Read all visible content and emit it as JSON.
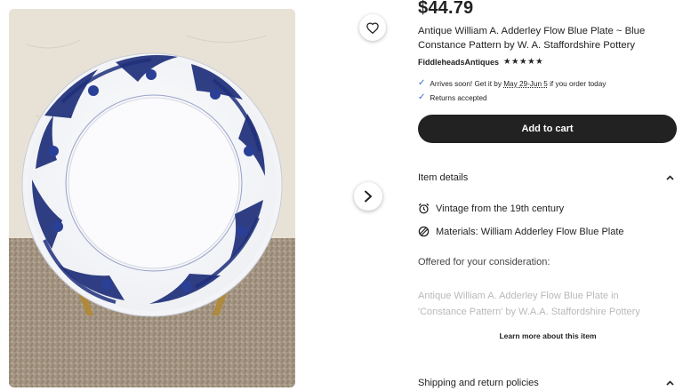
{
  "listing": {
    "price": "$44.79",
    "title": "Antique William A. Adderley Flow Blue Plate ~ Blue Constance Pattern by W. A. Staffordshire Pottery",
    "shop_name": "FiddleheadsAntiques",
    "rating_stars": "★★★★★"
  },
  "perks": {
    "arrival_prefix": "Arrives soon! Get it by ",
    "arrival_dates": "May 29-Jun 5",
    "arrival_suffix": " if you order today",
    "returns": "Returns accepted"
  },
  "actions": {
    "add_to_cart": "Add to cart"
  },
  "item_details": {
    "heading": "Item details",
    "vintage": "Vintage from the 19th century",
    "materials": "Materials: William Adderley Flow Blue Plate",
    "description_intro": "Offered for your consideration:",
    "description_line1": "Antique William A. Adderley Flow Blue Plate in",
    "description_line2": "'Constance Pattern' by W.A.A. Staffordshire Pottery",
    "learn_more": "Learn more about this item"
  },
  "shipping": {
    "heading": "Shipping and return policies"
  },
  "icons": {
    "favorite": "heart-icon",
    "next": "chevron-right-icon",
    "check": "check-icon",
    "alarm": "alarm-clock-icon",
    "materials": "materials-icon",
    "collapse": "chevron-up-icon"
  },
  "colors": {
    "button_bg": "#222222",
    "check": "#3b66d6",
    "plate_blue": "#1f2f7a",
    "faded_text": "#b9b9b9"
  }
}
